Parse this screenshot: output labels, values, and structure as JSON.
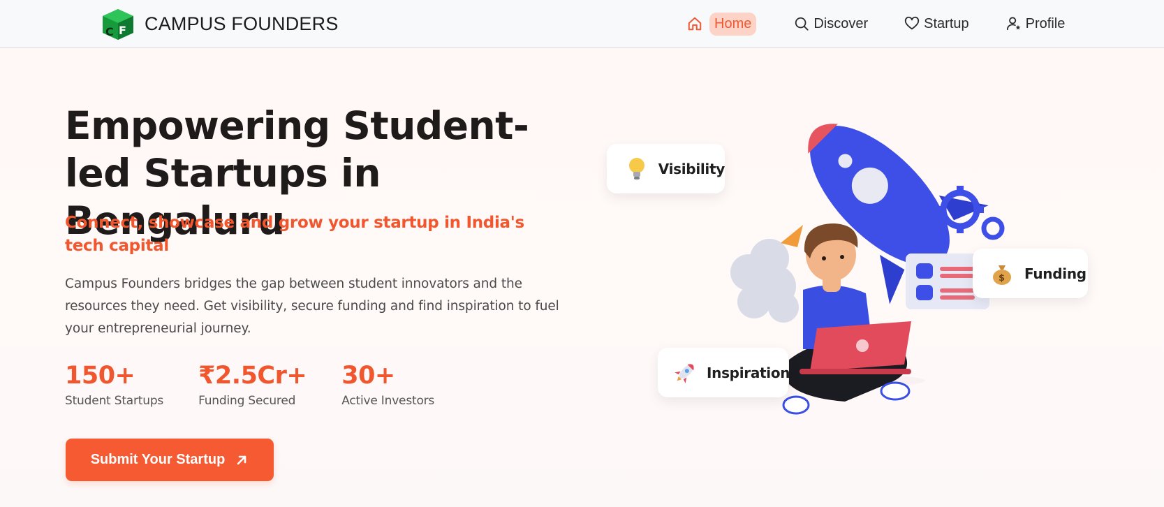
{
  "brand": {
    "name": "CAMPUS FOUNDERS",
    "logo_icon": "cf-cube-logo",
    "logo_color": "#1ea64a"
  },
  "nav": {
    "items": [
      {
        "label": "Home",
        "icon": "home-icon",
        "active": true
      },
      {
        "label": "Discover",
        "icon": "search-icon",
        "active": false
      },
      {
        "label": "Startup",
        "icon": "heart-icon",
        "active": false
      },
      {
        "label": "Profile",
        "icon": "user-star-icon",
        "active": false
      }
    ]
  },
  "hero": {
    "title": "Empowering Student-led Startups in Bengaluru",
    "subtitle": "Connect, showcase and grow your startup in India's tech capital",
    "description": "Campus Founders bridges the gap between student innovators and the resources they need. Get visibility, secure funding and find inspiration to fuel your entrepreneurial journey.",
    "stats": [
      {
        "value": "150+",
        "label": "Student Startups"
      },
      {
        "value": "₹2.5Cr+",
        "label": "Funding Secured"
      },
      {
        "value": "30+",
        "label": "Active Investors"
      }
    ],
    "cta_label": "Submit Your Startup"
  },
  "illustration": {
    "cards": [
      {
        "label": "Visibility",
        "icon": "lightbulb-icon"
      },
      {
        "label": "Funding",
        "icon": "money-bag-icon"
      },
      {
        "label": "Inspiration",
        "icon": "rocket-icon"
      }
    ]
  },
  "colors": {
    "accent": "#f55a33",
    "accent_soft": "#fcd3c6",
    "rocket_blue": "#3b4ee6",
    "laptop_red": "#e24b5b"
  }
}
